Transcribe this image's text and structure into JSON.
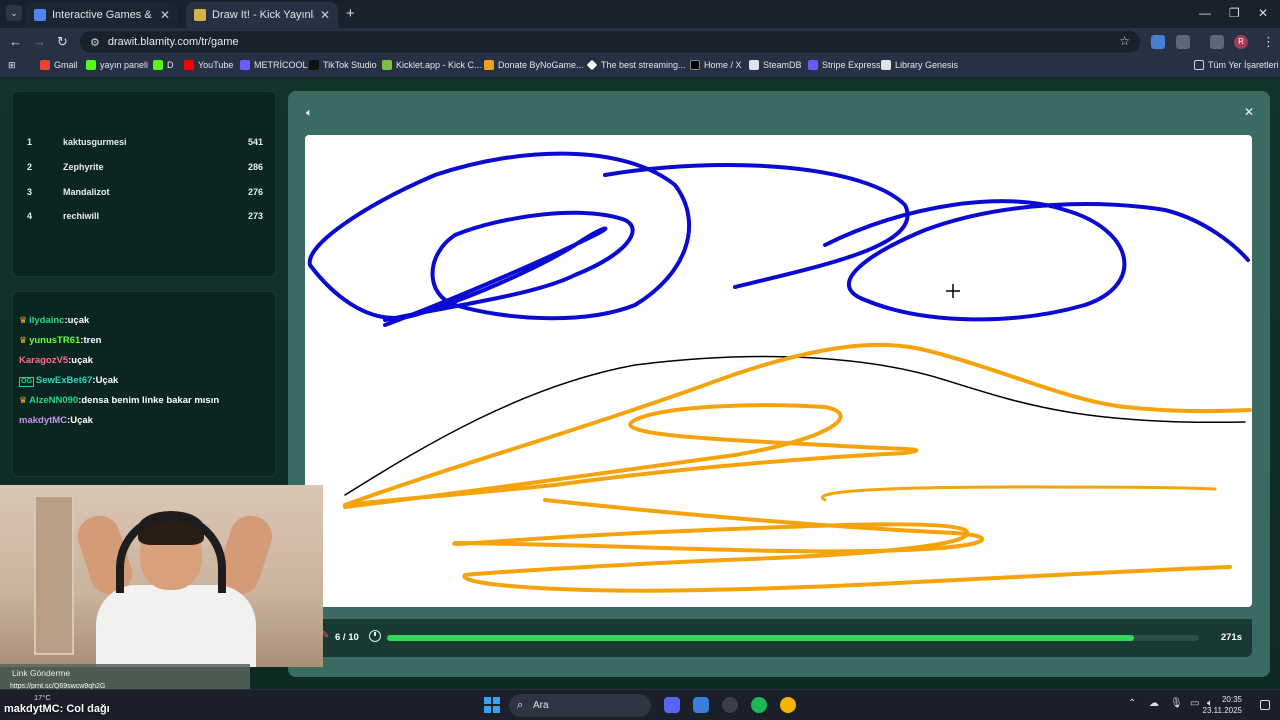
{
  "browser": {
    "tabs": [
      {
        "title": "Interactive Games & Streaming",
        "favicon_color": "#4f86f7"
      },
      {
        "title": "Draw It! - Kick Yayınları İçin Çizim",
        "favicon_color": "#d6b24a"
      }
    ],
    "url": "drawit.blamity.com/tr/game",
    "profile_initial": "R",
    "bookmarks": [
      {
        "label": "Gmail",
        "color": "#ea4335"
      },
      {
        "label": "yayın paneli",
        "color": "#53fc18"
      },
      {
        "label": "D",
        "color": "#53fc18"
      },
      {
        "label": "YouTube",
        "color": "#ff0000"
      },
      {
        "label": "METRİCOOL",
        "color": "#6b5cff"
      },
      {
        "label": "TikTok Studio",
        "color": "#111111"
      },
      {
        "label": "Kicklet.app - Kick C...",
        "color": "#7ac143"
      },
      {
        "label": "Donate ByNoGame...",
        "color": "#f0a020"
      },
      {
        "label": "The best streaming...",
        "color": "#ffffff"
      },
      {
        "label": "Home / X",
        "color": "#000000"
      },
      {
        "label": "SteamDB",
        "color": "#ffffff"
      },
      {
        "label": "Stripe Express",
        "color": "#635bff"
      },
      {
        "label": "Library Genesis",
        "color": "#ffffff"
      }
    ],
    "all_bookmarks_label": "Tüm Yer İşaretleri"
  },
  "leaderboard": [
    {
      "rank": "1",
      "name": "kaktusgurmesi",
      "score": "541"
    },
    {
      "rank": "2",
      "name": "Zephyrite",
      "score": "286"
    },
    {
      "rank": "3",
      "name": "Mandalizot",
      "score": "276"
    },
    {
      "rank": "4",
      "name": "rechiwill",
      "score": "273"
    }
  ],
  "chat": [
    {
      "user": "ilydainc",
      "text": ":uçak",
      "badge": "crown",
      "color": "#2ad489"
    },
    {
      "user": "yunusTR61",
      "text": ":tren",
      "badge": "crown",
      "color": "#63ff3c"
    },
    {
      "user": "KaragozV5",
      "text": ":uçak",
      "badge": "",
      "color": "#ff6b8b"
    },
    {
      "user": "SewExBet67",
      "text": ":Uçak",
      "badge": "og",
      "color": "#2ad4c4"
    },
    {
      "user": "AlzeNN090",
      "text": ":densa benim linke bakar mısın",
      "badge": "crown",
      "color": "#2ad489"
    },
    {
      "user": "makdytMC",
      "text": ":Uçak",
      "badge": "",
      "color": "#c792ea"
    }
  ],
  "game": {
    "round": "6 / 10",
    "time_left": "271s",
    "progress": 0.92,
    "pen_color_blue": "#0a0ad2",
    "pen_color_orange": "#f5a30b",
    "pen_color_black": "#000000"
  },
  "stream_overlay": {
    "notice_title": "Link Gönderme",
    "notice_link": "https://prnt.sc/Q69swcw9qh2G",
    "chat_user": "makdytMC",
    "chat_text": ": Col dağı"
  },
  "taskbar": {
    "weather": "17°C",
    "search_label": "Ara",
    "time": "20:35",
    "date": "23.11.2025"
  }
}
